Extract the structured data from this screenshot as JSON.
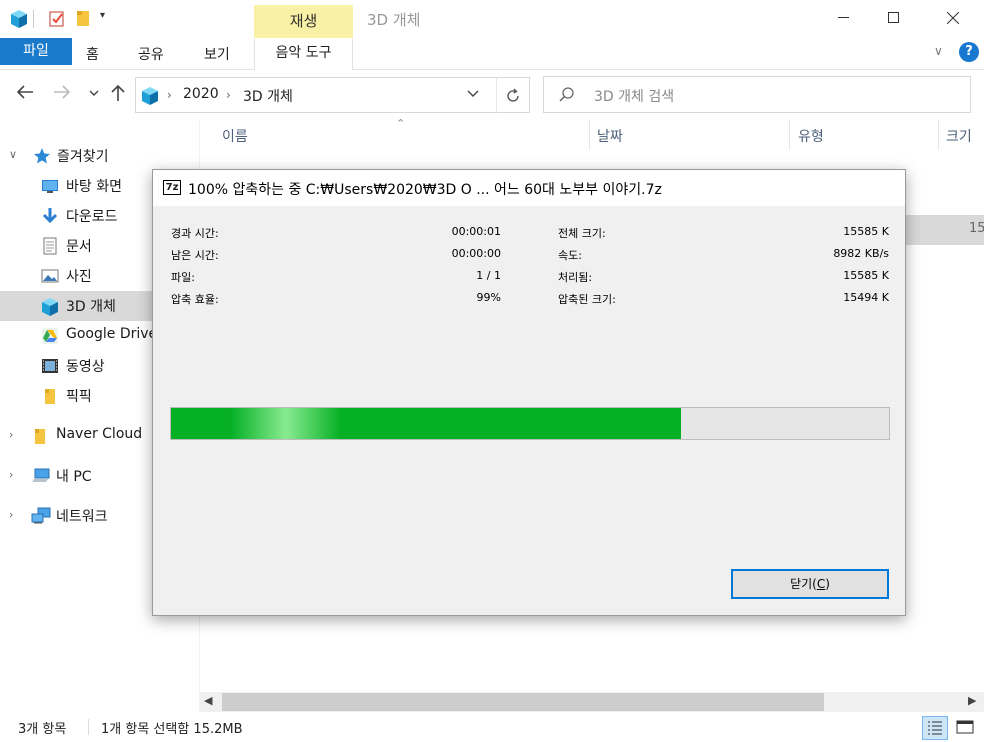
{
  "titlebar": {
    "contextual_tab": "재생",
    "window_title": "3D 개체"
  },
  "ribbon": {
    "file": "파일",
    "home": "홈",
    "share": "공유",
    "view": "보기",
    "music_tools": "음악 도구"
  },
  "address": {
    "crumbs": [
      "2020",
      "3D 개체"
    ],
    "search_placeholder": "3D 개체 검색"
  },
  "sidebar": {
    "quick_access": "즐겨찾기",
    "items": [
      {
        "label": "바탕 화면",
        "icon": "desktop-icon"
      },
      {
        "label": "다운로드",
        "icon": "download-icon"
      },
      {
        "label": "문서",
        "icon": "document-icon"
      },
      {
        "label": "사진",
        "icon": "pictures-icon"
      },
      {
        "label": "3D 개체",
        "icon": "3d-objects-icon",
        "selected": true
      },
      {
        "label": "Google Drive",
        "icon": "google-drive-icon"
      },
      {
        "label": "동영상",
        "icon": "videos-icon"
      },
      {
        "label": "픽픽",
        "icon": "folder-icon"
      }
    ],
    "naver_cloud": "Naver Cloud",
    "this_pc": "내 PC",
    "network": "네트워크"
  },
  "columns": {
    "name": "이름",
    "date": "날짜",
    "type": "유형",
    "size": "크기"
  },
  "file_row": {
    "size_partial": "15"
  },
  "status": {
    "item_count": "3개 항목",
    "selection": "1개 항목 선택함 15.2MB"
  },
  "dialog": {
    "icon_text": "7z",
    "title": "100% 압축하는 중 C:₩Users₩2020₩3D O ...  어느 60대 노부부 이야기.7z",
    "left": [
      {
        "label": "경과 시간:",
        "value": "00:00:01"
      },
      {
        "label": "남은 시간:",
        "value": "00:00:00"
      },
      {
        "label": "파일:",
        "value": "1 / 1"
      },
      {
        "label": "압축 효율:",
        "value": "99%"
      }
    ],
    "right": [
      {
        "label": "전체 크기:",
        "value": "15585 K"
      },
      {
        "label": "속도:",
        "value": "8982 KB/s"
      },
      {
        "label": "처리됨:",
        "value": "15585 K"
      },
      {
        "label": "압축된 크기:",
        "value": "15494 K"
      }
    ],
    "progress_fraction": 0.71,
    "progress_color": "#06b025",
    "close_label_main": "닫기(",
    "close_label_key": "C",
    "close_label_end": ")"
  }
}
